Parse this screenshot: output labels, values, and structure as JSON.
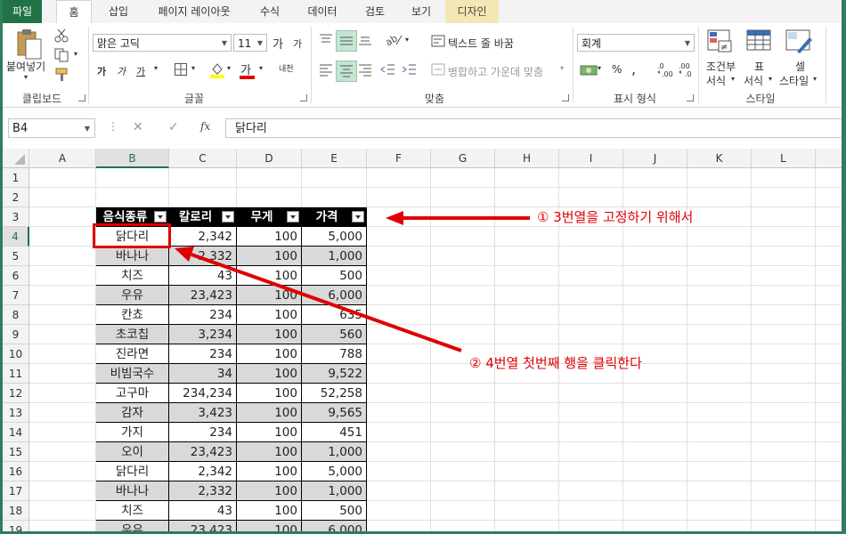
{
  "ribbon_tabs": [
    "파일",
    "홈",
    "삽입",
    "페이지 레이아웃",
    "수식",
    "데이터",
    "검토",
    "보기",
    "디자인"
  ],
  "ribbon": {
    "clipboard": {
      "paste_label": "붙여넣기",
      "group_label": "클립보드"
    },
    "font": {
      "font_name": "맑은 고딕",
      "font_size": "11",
      "grow": "가",
      "shrink": "가",
      "bold": "가",
      "italic": "가",
      "underline": "가",
      "font_color_glyph": "가",
      "phonetic": "내천",
      "group_label": "글꼴"
    },
    "alignment": {
      "wrap_text": "텍스트 줄 바꿈",
      "merge_center": "병합하고 가운데 맞춤",
      "group_label": "맞춤"
    },
    "number": {
      "format": "회계",
      "percent": "%",
      "comma": ",",
      "group_label": "표시 형식"
    },
    "styles": {
      "conditional_line1": "조건부",
      "conditional_line2": "서식",
      "table_line1": "표",
      "table_line2": "서식",
      "cell_line1": "셀",
      "cell_line2": "스타일",
      "group_label": "스타일"
    }
  },
  "formula_bar": {
    "name_box": "B4",
    "cancel": "✕",
    "enter": "✓",
    "fx": "fx",
    "content": "닭다리"
  },
  "columns": [
    "A",
    "B",
    "C",
    "D",
    "E",
    "F",
    "G",
    "H",
    "I",
    "J",
    "K",
    "L"
  ],
  "rows": [
    "1",
    "2",
    "3",
    "4",
    "5",
    "6",
    "7",
    "8",
    "9",
    "10",
    "11",
    "12",
    "13",
    "14",
    "15",
    "16",
    "17",
    "18",
    "19"
  ],
  "table": {
    "headers": [
      "음식종류",
      "칼로리",
      "무게",
      "가격"
    ],
    "rows": [
      [
        "닭다리",
        "2,342",
        "100",
        "5,000"
      ],
      [
        "바나나",
        "2,332",
        "100",
        "1,000"
      ],
      [
        "치즈",
        "43",
        "100",
        "500"
      ],
      [
        "우유",
        "23,423",
        "100",
        "6,000"
      ],
      [
        "칸쵸",
        "234",
        "100",
        "635"
      ],
      [
        "초코칩",
        "3,234",
        "100",
        "560"
      ],
      [
        "진라면",
        "234",
        "100",
        "788"
      ],
      [
        "비빔국수",
        "34",
        "100",
        "9,522"
      ],
      [
        "고구마",
        "234,234",
        "100",
        "52,258"
      ],
      [
        "감자",
        "3,423",
        "100",
        "9,565"
      ],
      [
        "가지",
        "234",
        "100",
        "451"
      ],
      [
        "오이",
        "23,423",
        "100",
        "1,000"
      ],
      [
        "닭다리",
        "2,342",
        "100",
        "5,000"
      ],
      [
        "바나나",
        "2,332",
        "100",
        "1,000"
      ],
      [
        "치즈",
        "43",
        "100",
        "500"
      ],
      [
        "우유",
        "23,423",
        "100",
        "6,000"
      ]
    ]
  },
  "annotations": {
    "step1": "① 3번열을 고정하기 위해서",
    "step2": "② 4번열 첫번째 행을 클릭한다"
  },
  "colors": {
    "excel_green": "#217346",
    "annotation_red": "#e00000",
    "stripe_gray": "#d9d9d9",
    "header_black": "#000000"
  }
}
